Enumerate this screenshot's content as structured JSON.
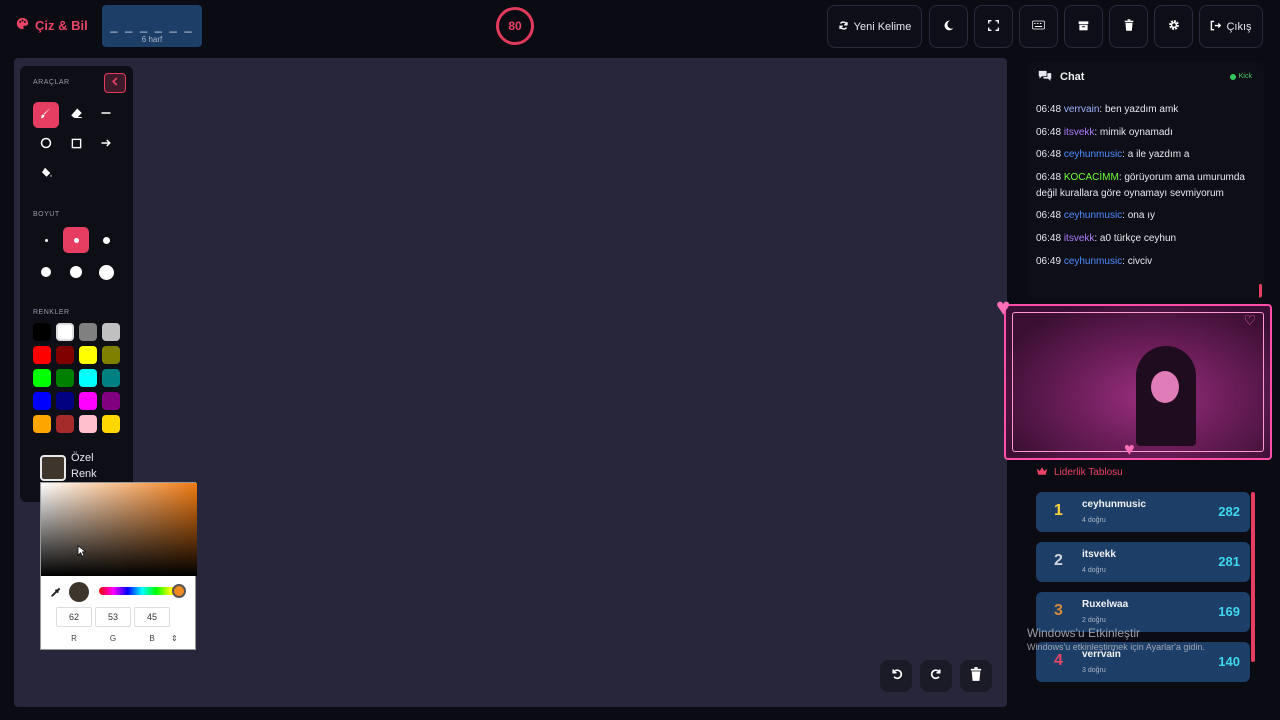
{
  "app": {
    "title": "Çiz & Bil"
  },
  "word": {
    "mask": "_ _ _ _ _ _",
    "hint": "6 harf"
  },
  "timer": {
    "value": "80"
  },
  "toolbar": {
    "new_word_label": "Yeni Kelime",
    "exit_label": "Çıkış"
  },
  "tools_panel": {
    "tools_title": "ARAÇLAR",
    "size_title": "BOYUT",
    "colors_title": "RENKLER",
    "custom_color_line1": "Özel",
    "custom_color_line2": "Renk",
    "palette": [
      "#000000",
      "#ffffff",
      "#808080",
      "#c0c0c0",
      "#ff0000",
      "#800000",
      "#ffff00",
      "#808000",
      "#00ff00",
      "#008000",
      "#00ffff",
      "#008080",
      "#0000ff",
      "#000080",
      "#ff00ff",
      "#800080",
      "#ffa500",
      "#a52a2a",
      "#ffc0cb",
      "#ffd700"
    ]
  },
  "color_picker": {
    "r": "62",
    "g": "53",
    "b": "45",
    "r_label": "R",
    "g_label": "G",
    "b_label": "B",
    "selected": "#3e352d"
  },
  "chat": {
    "title": "Chat",
    "platform": "Kick",
    "messages": [
      {
        "time": "06:48",
        "user": "verrvain",
        "color": "#9fb4ff",
        "text": ": ben yazdım amk"
      },
      {
        "time": "06:48",
        "user": "itsvekk",
        "color": "#b07cff",
        "text": ": mimik oynamadı"
      },
      {
        "time": "06:48",
        "user": "ceyhunmusic",
        "color": "#4e8dff",
        "text": ": a ile yazdım a"
      },
      {
        "time": "06:48",
        "user": "KOCACİMM",
        "color": "#6dff3a",
        "text": ": görüyorum ama umurumda değil kurallara göre oynamayı sevmiyorum"
      },
      {
        "time": "06:48",
        "user": "ceyhunmusic",
        "color": "#4e8dff",
        "text": ": ona ıy"
      },
      {
        "time": "06:48",
        "user": "itsvekk",
        "color": "#b07cff",
        "text": ": a0 türkçe ceyhun"
      },
      {
        "time": "06:49",
        "user": "ceyhunmusic",
        "color": "#4e8dff",
        "text": ": civciv"
      }
    ]
  },
  "leaderboard": {
    "title": "Liderlik Tablosu",
    "rows": [
      {
        "rank": "1",
        "name": "ceyhunmusic",
        "sub": "4 doğru",
        "score": "282",
        "rank_color": "#ffd23f"
      },
      {
        "rank": "2",
        "name": "itsvekk",
        "sub": "4 doğru",
        "score": "281",
        "rank_color": "#d0d4dc"
      },
      {
        "rank": "3",
        "name": "Ruxelwaa",
        "sub": "2 doğru",
        "score": "169",
        "rank_color": "#d98a3a"
      },
      {
        "rank": "4",
        "name": "verrvain",
        "sub": "3 doğru",
        "score": "140",
        "rank_color": "#e94565"
      }
    ]
  },
  "watermark": {
    "line1": "Windows'u Etkinleştir",
    "line2": "Windows'u etkinleştirmek için Ayarlar'a gidin."
  }
}
